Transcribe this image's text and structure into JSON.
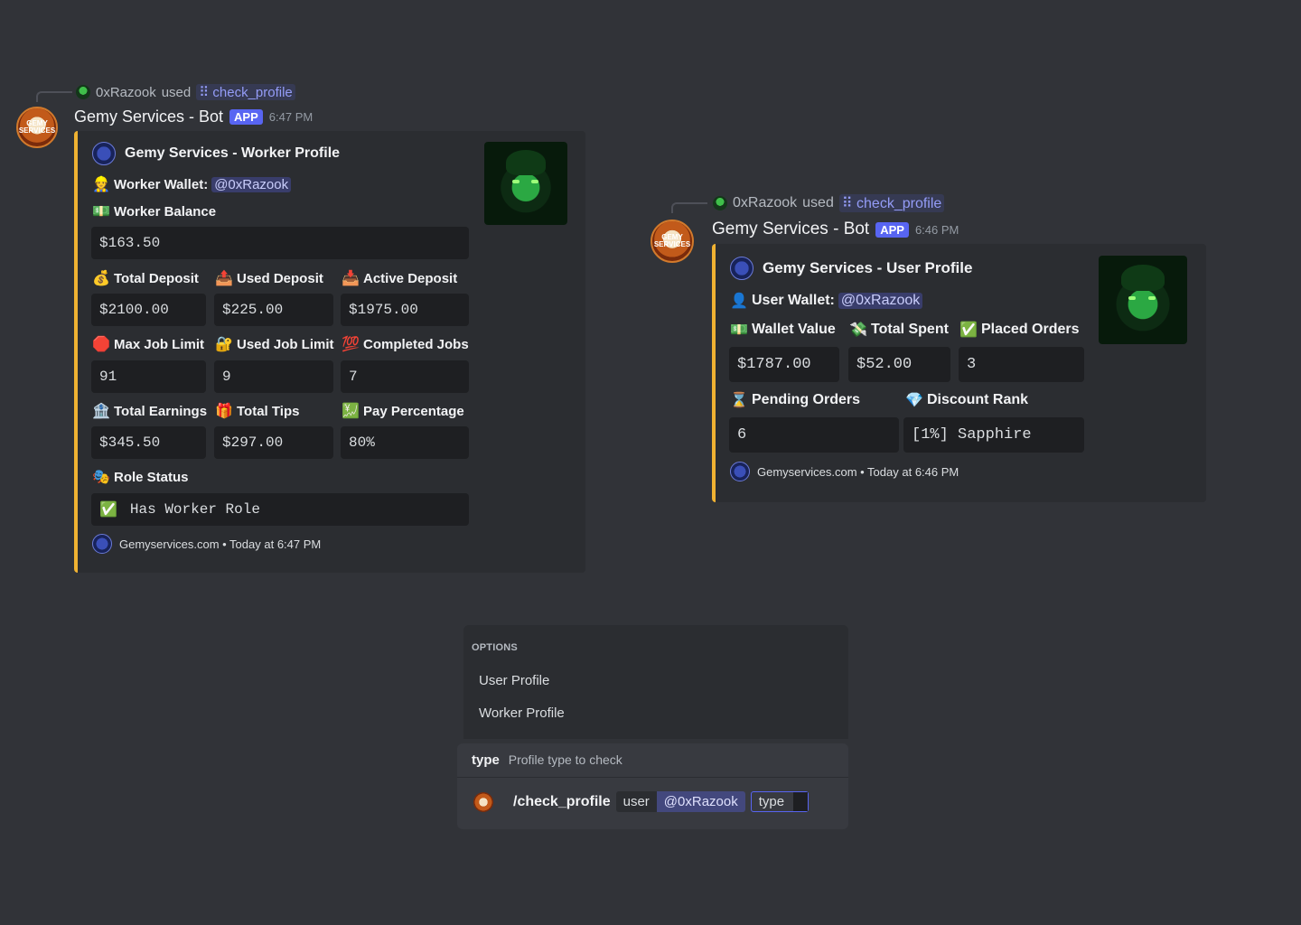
{
  "worker_msg": {
    "reply_user": "0xRazook",
    "reply_used": "used",
    "reply_command": "check_profile",
    "bot_name": "Gemy Services - Bot",
    "app_badge": "APP",
    "time": "6:47 PM",
    "avatar_text": "GEMY SERVICES",
    "embed": {
      "author": "Gemy Services - Worker Profile",
      "wallet_label": "Worker Wallet:",
      "wallet_mention": "@0xRazook",
      "balance_label": "Worker Balance",
      "balance_value": "$163.50",
      "fields": [
        {
          "emoji": "💰",
          "name": "Total Deposit",
          "value": "$2100.00"
        },
        {
          "emoji": "📤",
          "name": "Used Deposit",
          "value": "$225.00"
        },
        {
          "emoji": "📥",
          "name": "Active Deposit",
          "value": "$1975.00"
        },
        {
          "emoji": "🛑",
          "name": "Max Job Limit",
          "value": "91"
        },
        {
          "emoji": "🔐",
          "name": "Used Job Limit",
          "value": "9"
        },
        {
          "emoji": "💯",
          "name": "Completed Jobs",
          "value": "7"
        },
        {
          "emoji": "🏦",
          "name": "Total Earnings",
          "value": "$345.50"
        },
        {
          "emoji": "🎁",
          "name": "Total Tips",
          "value": "$297.00"
        },
        {
          "emoji": "💹",
          "name": "Pay Percentage",
          "value": "80%"
        }
      ],
      "role_label": "Role Status",
      "role_check": "✅",
      "role_value": "Has Worker Role",
      "footer": "Gemyservices.com • Today at 6:47 PM"
    }
  },
  "user_msg": {
    "reply_user": "0xRazook",
    "reply_used": "used",
    "reply_command": "check_profile",
    "bot_name": "Gemy Services - Bot",
    "app_badge": "APP",
    "time": "6:46 PM",
    "avatar_text": "GEMY SERVICES",
    "embed": {
      "author": "Gemy Services - User Profile",
      "wallet_label": "User Wallet:",
      "wallet_mention": "@0xRazook",
      "fields": [
        {
          "emoji": "💵",
          "name": "Wallet Value",
          "value": "$1787.00"
        },
        {
          "emoji": "💸",
          "name": "Total Spent",
          "value": "$52.00"
        },
        {
          "emoji": "✅",
          "name": "Placed Orders",
          "value": "3"
        },
        {
          "emoji": "⌛",
          "name": "Pending Orders",
          "value": "6"
        },
        {
          "emoji": "💎",
          "name": "Discount Rank",
          "value": "[1%] Sapphire"
        }
      ],
      "footer": "Gemyservices.com • Today at 6:46 PM"
    }
  },
  "popup": {
    "title": "OPTIONS",
    "items": [
      "User Profile",
      "Worker Profile"
    ]
  },
  "command_bar": {
    "option_name": "type",
    "option_desc": "Profile type to check",
    "command": "/check_profile",
    "user_label": "user",
    "user_value": "@0xRazook",
    "active_option": "type"
  },
  "emoji": {
    "worker": "👷",
    "balance": "💵",
    "user": "👤",
    "role": "🎭"
  }
}
